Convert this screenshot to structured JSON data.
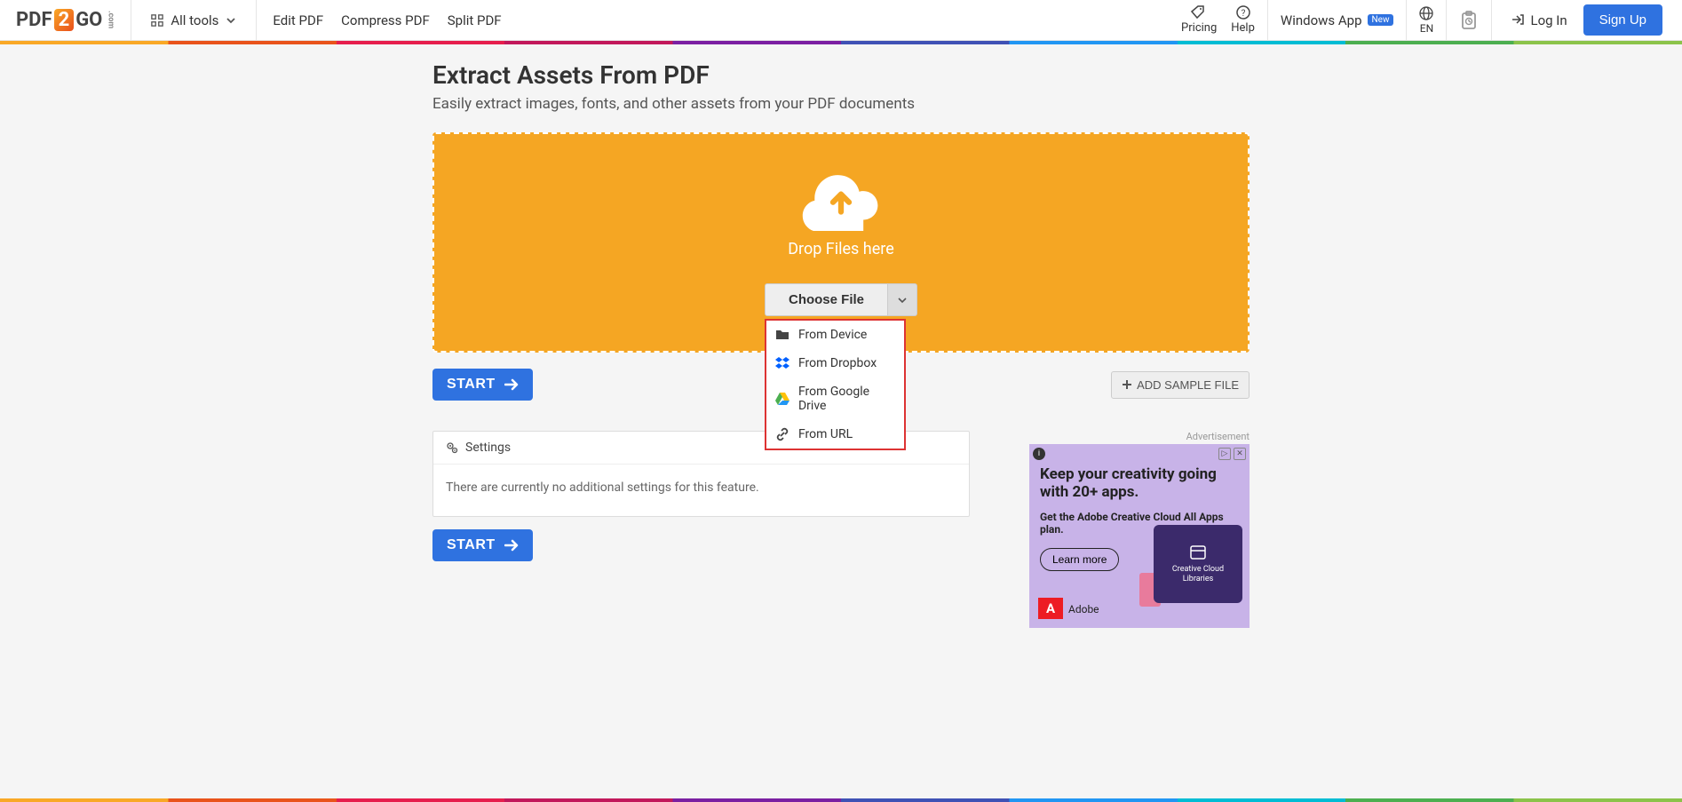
{
  "logo": {
    "part1": "PDF",
    "part2": "2",
    "part3": "GO",
    "suffix": ".com"
  },
  "nav": {
    "all_tools": "All tools",
    "links": [
      "Edit PDF",
      "Compress PDF",
      "Split PDF"
    ]
  },
  "header_right": {
    "pricing": "Pricing",
    "help": "Help",
    "platform": "Windows App",
    "platform_badge": "New",
    "lang": "EN",
    "login": "Log In",
    "signup": "Sign Up"
  },
  "page": {
    "title": "Extract Assets From PDF",
    "subtitle": "Easily extract images, fonts, and other assets from your PDF documents"
  },
  "drop": {
    "text": "Drop Files here",
    "choose": "Choose File",
    "options": [
      {
        "label": "From Device",
        "icon": "folder"
      },
      {
        "label": "From Dropbox",
        "icon": "dropbox"
      },
      {
        "label": "From Google Drive",
        "icon": "gdrive"
      },
      {
        "label": "From URL",
        "icon": "link"
      }
    ]
  },
  "actions": {
    "start": "START",
    "add_sample": "ADD SAMPLE FILE"
  },
  "settings": {
    "heading": "Settings",
    "empty": "There are currently no additional settings for this feature."
  },
  "ad": {
    "label": "Advertisement",
    "title": "Keep your creativity going with 20+ apps.",
    "sub": "Get the Adobe Creative Cloud All Apps plan.",
    "cta": "Learn more",
    "card_text": "Creative Cloud Libraries",
    "brand_mark": "A",
    "brand": "Adobe"
  }
}
